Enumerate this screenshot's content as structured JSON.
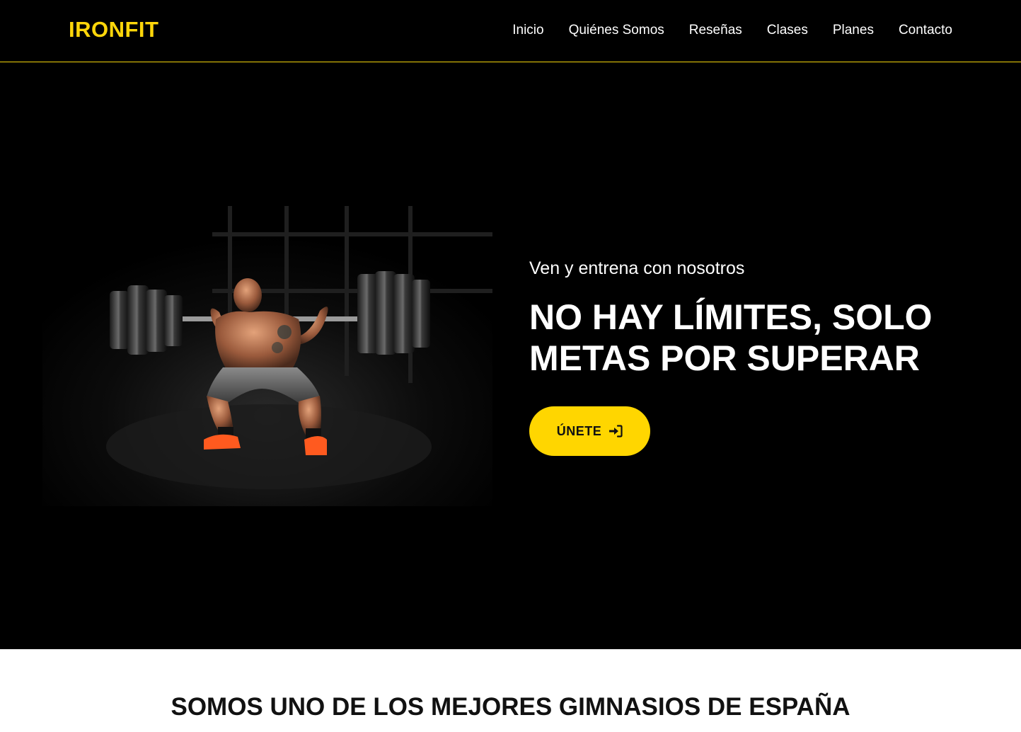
{
  "brand": "IRONFIT",
  "nav": {
    "items": [
      {
        "label": "Inicio"
      },
      {
        "label": "Quiénes Somos"
      },
      {
        "label": "Reseñas"
      },
      {
        "label": "Clases"
      },
      {
        "label": "Planes"
      },
      {
        "label": "Contacto"
      }
    ]
  },
  "hero": {
    "subtitle": "Ven y entrena con nosotros",
    "title_line1": "NO HAY LÍMITES, SOLO",
    "title_line2": "METAS POR SUPERAR",
    "cta_label": "ÚNETE",
    "cta_icon": "sign-in-icon",
    "image_icon": "weightlifter-squat-photo"
  },
  "about": {
    "title": "SOMOS UNO DE LOS MEJORES GIMNASIOS DE ESPAÑA"
  },
  "colors": {
    "accent": "#ffd600",
    "background": "#000000",
    "text_light": "#ffffff",
    "text_dark": "#111111"
  }
}
